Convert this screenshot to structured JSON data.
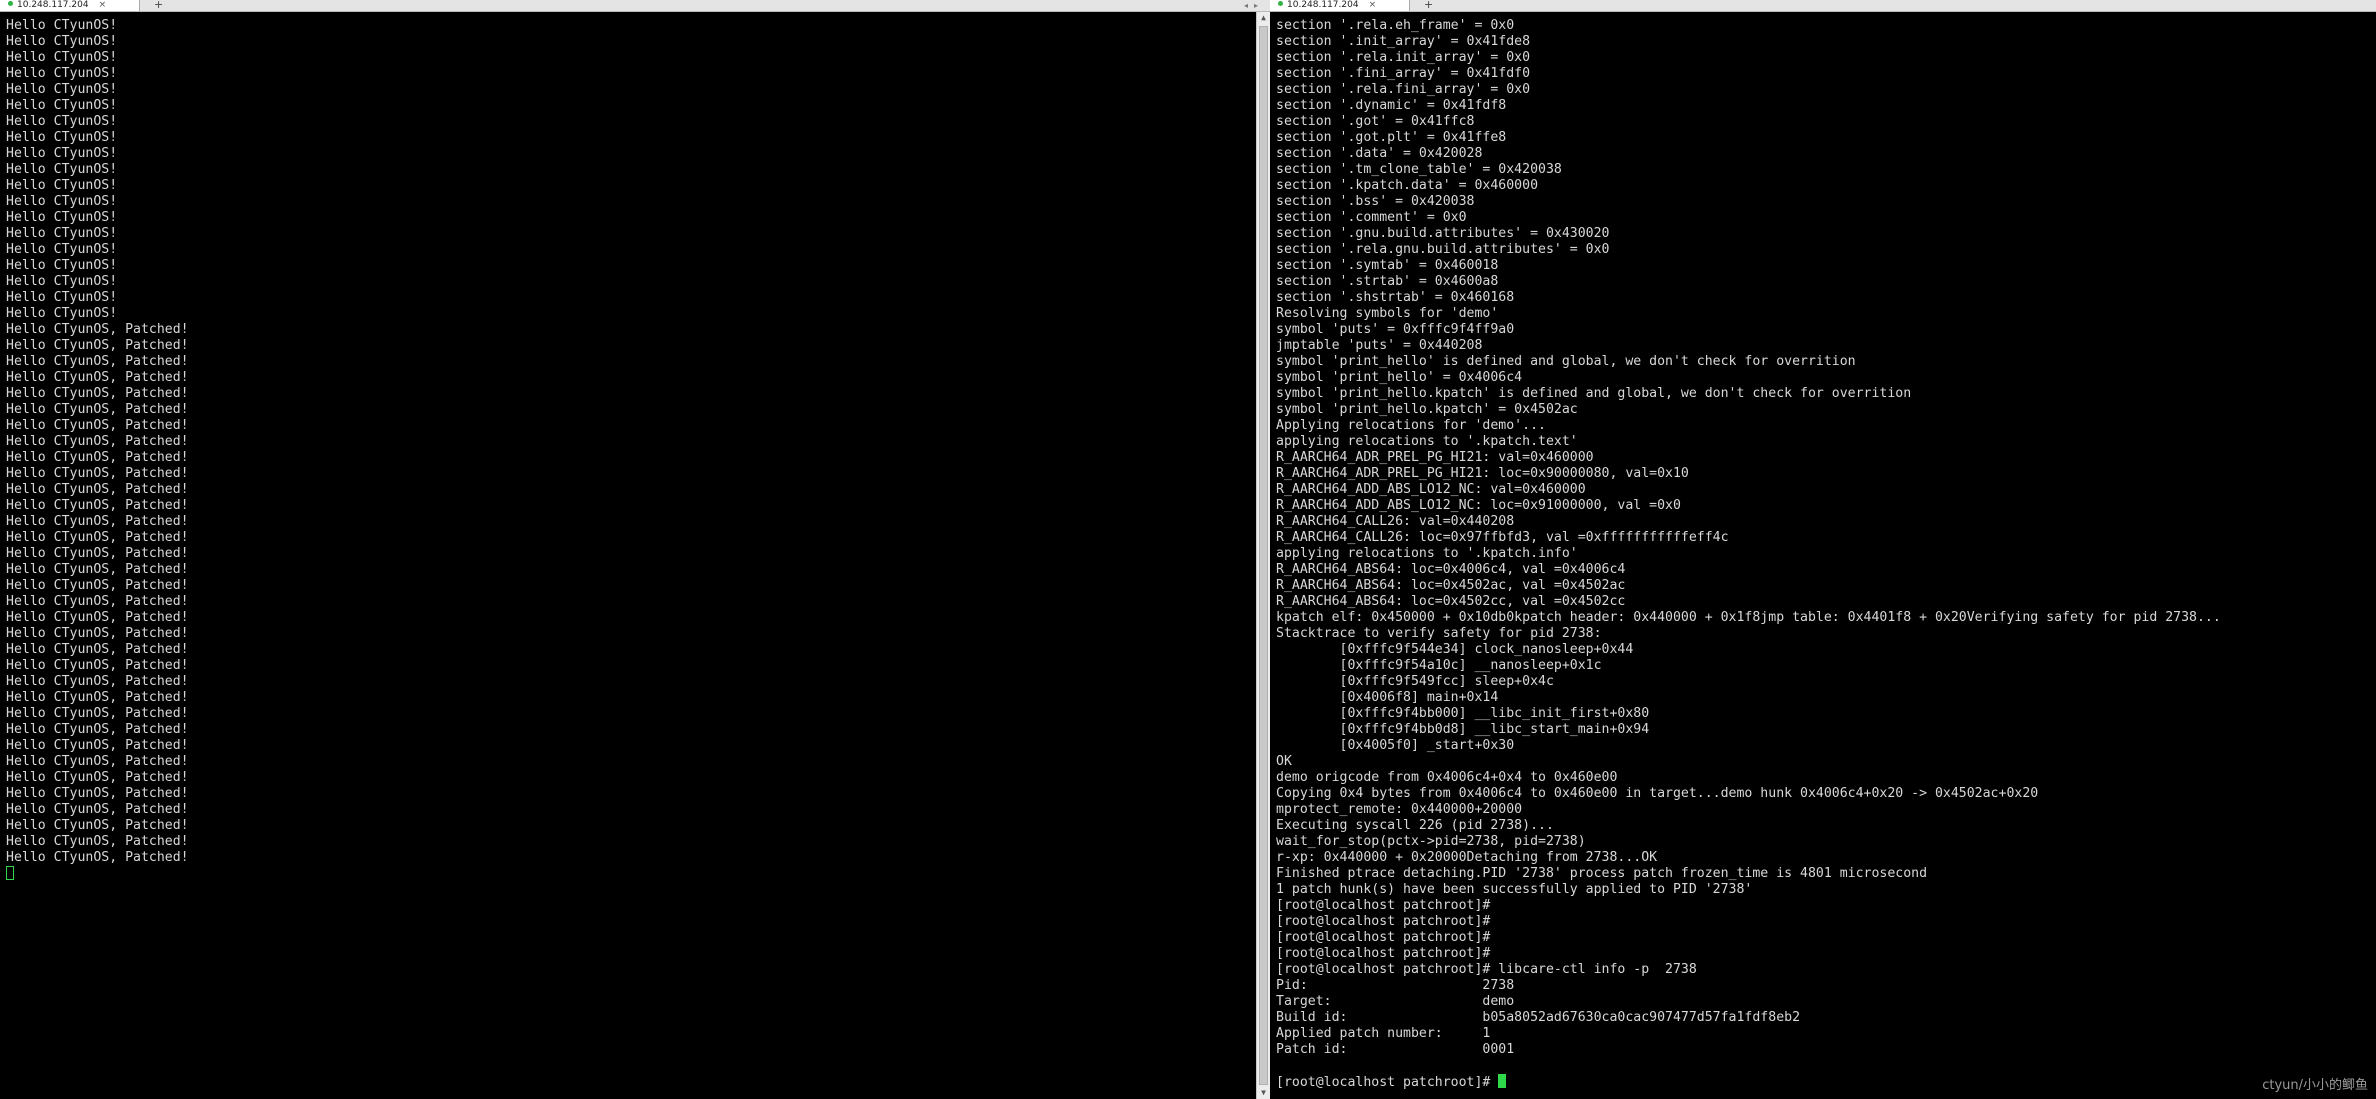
{
  "left_pane": {
    "tab_title": "10.248.117.204",
    "tab_close": "×",
    "tab_add": "+",
    "lines": [
      "Hello CTyunOS!",
      "Hello CTyunOS!",
      "Hello CTyunOS!",
      "Hello CTyunOS!",
      "Hello CTyunOS!",
      "Hello CTyunOS!",
      "Hello CTyunOS!",
      "Hello CTyunOS!",
      "Hello CTyunOS!",
      "Hello CTyunOS!",
      "Hello CTyunOS!",
      "Hello CTyunOS!",
      "Hello CTyunOS!",
      "Hello CTyunOS!",
      "Hello CTyunOS!",
      "Hello CTyunOS!",
      "Hello CTyunOS!",
      "Hello CTyunOS!",
      "Hello CTyunOS!",
      "Hello CTyunOS, Patched!",
      "Hello CTyunOS, Patched!",
      "Hello CTyunOS, Patched!",
      "Hello CTyunOS, Patched!",
      "Hello CTyunOS, Patched!",
      "Hello CTyunOS, Patched!",
      "Hello CTyunOS, Patched!",
      "Hello CTyunOS, Patched!",
      "Hello CTyunOS, Patched!",
      "Hello CTyunOS, Patched!",
      "Hello CTyunOS, Patched!",
      "Hello CTyunOS, Patched!",
      "Hello CTyunOS, Patched!",
      "Hello CTyunOS, Patched!",
      "Hello CTyunOS, Patched!",
      "Hello CTyunOS, Patched!",
      "Hello CTyunOS, Patched!",
      "Hello CTyunOS, Patched!",
      "Hello CTyunOS, Patched!",
      "Hello CTyunOS, Patched!",
      "Hello CTyunOS, Patched!",
      "Hello CTyunOS, Patched!",
      "Hello CTyunOS, Patched!",
      "Hello CTyunOS, Patched!",
      "Hello CTyunOS, Patched!",
      "Hello CTyunOS, Patched!",
      "Hello CTyunOS, Patched!",
      "Hello CTyunOS, Patched!",
      "Hello CTyunOS, Patched!",
      "Hello CTyunOS, Patched!",
      "Hello CTyunOS, Patched!",
      "Hello CTyunOS, Patched!",
      "Hello CTyunOS, Patched!",
      "Hello CTyunOS, Patched!"
    ]
  },
  "right_pane": {
    "tab_title": "10.248.117.204",
    "tab_close": "×",
    "tab_add": "+",
    "lines": [
      "section '.rela.eh_frame' = 0x0",
      "section '.init_array' = 0x41fde8",
      "section '.rela.init_array' = 0x0",
      "section '.fini_array' = 0x41fdf0",
      "section '.rela.fini_array' = 0x0",
      "section '.dynamic' = 0x41fdf8",
      "section '.got' = 0x41ffc8",
      "section '.got.plt' = 0x41ffe8",
      "section '.data' = 0x420028",
      "section '.tm_clone_table' = 0x420038",
      "section '.kpatch.data' = 0x460000",
      "section '.bss' = 0x420038",
      "section '.comment' = 0x0",
      "section '.gnu.build.attributes' = 0x430020",
      "section '.rela.gnu.build.attributes' = 0x0",
      "section '.symtab' = 0x460018",
      "section '.strtab' = 0x4600a8",
      "section '.shstrtab' = 0x460168",
      "Resolving symbols for 'demo'",
      "symbol 'puts' = 0xfffc9f4ff9a0",
      "jmptable 'puts' = 0x440208",
      "symbol 'print_hello' is defined and global, we don't check for overrition",
      "symbol 'print_hello' = 0x4006c4",
      "symbol 'print_hello.kpatch' is defined and global, we don't check for overrition",
      "symbol 'print_hello.kpatch' = 0x4502ac",
      "Applying relocations for 'demo'...",
      "applying relocations to '.kpatch.text'",
      "R_AARCH64_ADR_PREL_PG_HI21: val=0x460000",
      "R_AARCH64_ADR_PREL_PG_HI21: loc=0x90000080, val=0x10",
      "R_AARCH64_ADD_ABS_LO12_NC: val=0x460000",
      "R_AARCH64_ADD_ABS_LO12_NC: loc=0x91000000, val =0x0",
      "R_AARCH64_CALL26: val=0x440208",
      "R_AARCH64_CALL26: loc=0x97ffbfd3, val =0xfffffffffffeff4c",
      "applying relocations to '.kpatch.info'",
      "R_AARCH64_ABS64: loc=0x4006c4, val =0x4006c4",
      "R_AARCH64_ABS64: loc=0x4502ac, val =0x4502ac",
      "R_AARCH64_ABS64: loc=0x4502cc, val =0x4502cc",
      "kpatch elf: 0x450000 + 0x10db0kpatch header: 0x440000 + 0x1f8jmp table: 0x4401f8 + 0x20Verifying safety for pid 2738...",
      "Stacktrace to verify safety for pid 2738:",
      "        [0xfffc9f544e34] clock_nanosleep+0x44",
      "        [0xfffc9f54a10c] __nanosleep+0x1c",
      "        [0xfffc9f549fcc] sleep+0x4c",
      "        [0x4006f8] main+0x14",
      "        [0xfffc9f4bb000] __libc_init_first+0x80",
      "        [0xfffc9f4bb0d8] __libc_start_main+0x94",
      "        [0x4005f0] _start+0x30",
      "OK",
      "demo origcode from 0x4006c4+0x4 to 0x460e00",
      "Copying 0x4 bytes from 0x4006c4 to 0x460e00 in target...demo hunk 0x4006c4+0x20 -> 0x4502ac+0x20",
      "mprotect_remote: 0x440000+20000",
      "Executing syscall 226 (pid 2738)...",
      "wait_for_stop(pctx->pid=2738, pid=2738)",
      "r-xp: 0x440000 + 0x20000Detaching from 2738...OK",
      "Finished ptrace detaching.PID '2738' process patch frozen_time is 4801 microsecond",
      "1 patch hunk(s) have been successfully applied to PID '2738'",
      "[root@localhost patchroot]#",
      "[root@localhost patchroot]#",
      "[root@localhost patchroot]#",
      "[root@localhost patchroot]#",
      "[root@localhost patchroot]# libcare-ctl info -p  2738",
      "Pid:                      2738",
      "Target:                   demo",
      "Build id:                 b05a8052ad67630ca0cac907477d57fa1fdf8eb2",
      "Applied patch number:     1",
      "Patch id:                 0001",
      "",
      "[root@localhost patchroot]# "
    ]
  },
  "colors": {
    "terminal_bg": "#000000",
    "terminal_fg": "#d8d8d8",
    "cursor": "#2fd84a",
    "tab_indicator": "#2fb344"
  },
  "watermark": "ctyun/小小的鲫鱼"
}
